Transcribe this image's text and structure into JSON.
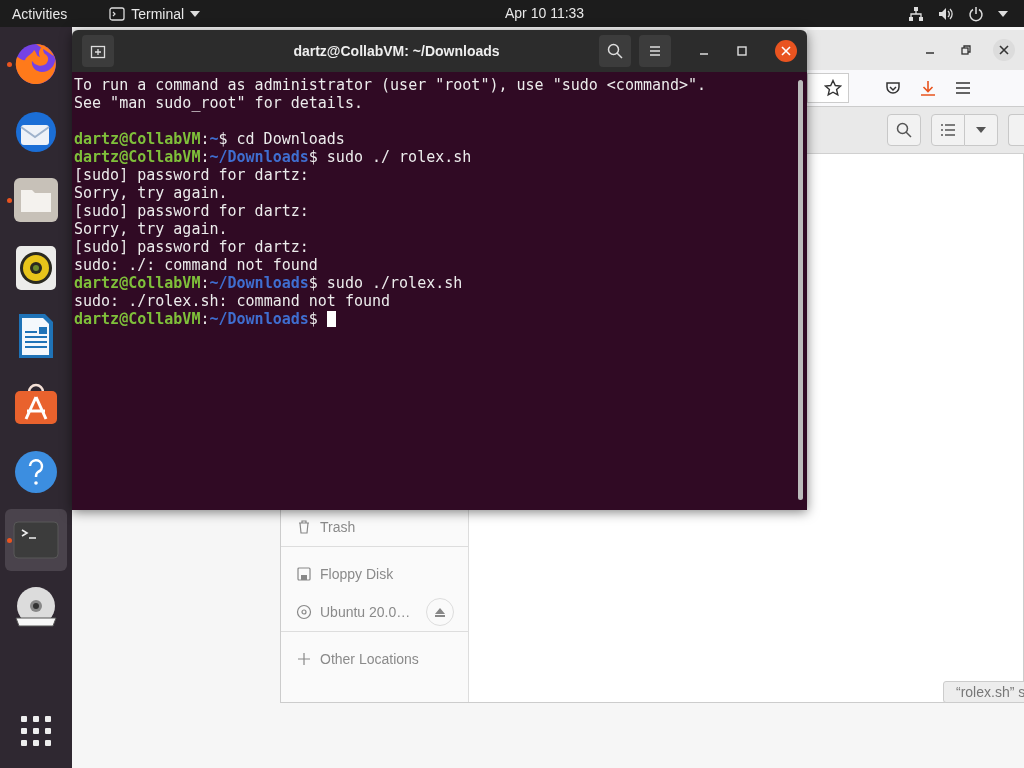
{
  "top_bar": {
    "activities": "Activities",
    "app_menu": "Terminal",
    "clock": "Apr 10  11:33"
  },
  "dock": {
    "items": [
      {
        "kind": "firefox",
        "running": true,
        "selected": false
      },
      {
        "kind": "thunderbird",
        "running": false,
        "selected": false
      },
      {
        "kind": "files",
        "running": true,
        "selected": false
      },
      {
        "kind": "rhythmbox",
        "running": false,
        "selected": false
      },
      {
        "kind": "writer",
        "running": false,
        "selected": false
      },
      {
        "kind": "software",
        "running": false,
        "selected": false
      },
      {
        "kind": "help",
        "running": false,
        "selected": false
      },
      {
        "kind": "terminal",
        "running": true,
        "selected": true
      },
      {
        "kind": "dvd",
        "running": false,
        "selected": false
      }
    ]
  },
  "terminal": {
    "title": "dartz@CollabVM: ~/Downloads",
    "lines": [
      {
        "kind": "output",
        "text": "To run a command as administrator (user \"root\"), use \"sudo <command>\"."
      },
      {
        "kind": "output",
        "text": "See \"man sudo_root\" for details."
      },
      {
        "kind": "blank"
      },
      {
        "kind": "prompt",
        "user": "dartz@CollabVM",
        "sep": ":",
        "path": "~",
        "sign": "$",
        "command": "cd Downloads",
        "cursor": false
      },
      {
        "kind": "prompt",
        "user": "dartz@CollabVM",
        "sep": ":",
        "path": "~/Downloads",
        "sign": "$",
        "command": "sudo ./ rolex.sh",
        "cursor": false
      },
      {
        "kind": "output",
        "text": "[sudo] password for dartz:"
      },
      {
        "kind": "output",
        "text": "Sorry, try again."
      },
      {
        "kind": "output",
        "text": "[sudo] password for dartz:"
      },
      {
        "kind": "output",
        "text": "Sorry, try again."
      },
      {
        "kind": "output",
        "text": "[sudo] password for dartz:"
      },
      {
        "kind": "output",
        "text": "sudo: ./: command not found"
      },
      {
        "kind": "prompt",
        "user": "dartz@CollabVM",
        "sep": ":",
        "path": "~/Downloads",
        "sign": "$",
        "command": "sudo ./rolex.sh",
        "cursor": false
      },
      {
        "kind": "output",
        "text": "sudo: ./rolex.sh: command not found"
      },
      {
        "kind": "prompt",
        "user": "dartz@CollabVM",
        "sep": ":",
        "path": "~/Downloads",
        "sign": "$",
        "cursor": true
      }
    ]
  },
  "files": {
    "sidebar": {
      "items": [
        {
          "kind": "trash",
          "label": "Trash",
          "eject": false,
          "group_end": true
        },
        {
          "kind": "floppy",
          "label": "Floppy Disk",
          "eject": false,
          "group_end": false
        },
        {
          "kind": "disc",
          "label": "Ubuntu 20.0…",
          "eject": true,
          "group_end": true
        },
        {
          "kind": "other",
          "label": "Other Locations",
          "eject": false,
          "group_end": false
        }
      ]
    },
    "tooltip": "“rolex.sh” s"
  }
}
